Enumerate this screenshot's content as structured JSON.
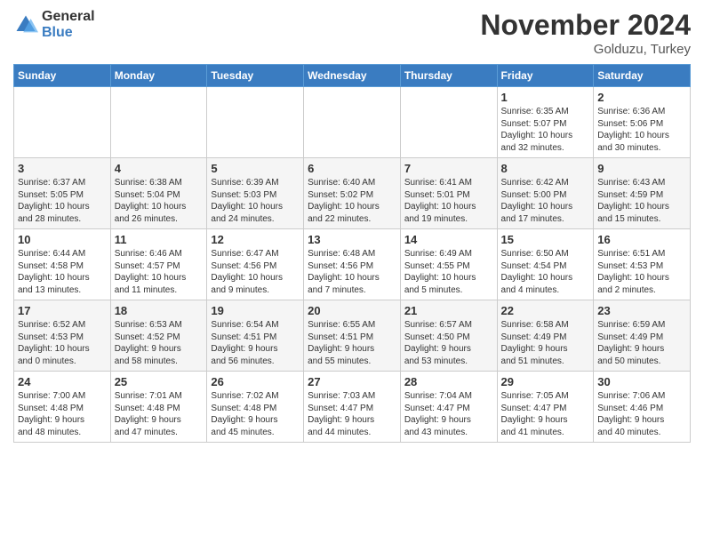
{
  "logo": {
    "general": "General",
    "blue": "Blue"
  },
  "title": "November 2024",
  "location": "Golduzu, Turkey",
  "days_of_week": [
    "Sunday",
    "Monday",
    "Tuesday",
    "Wednesday",
    "Thursday",
    "Friday",
    "Saturday"
  ],
  "weeks": [
    [
      {
        "day": "",
        "info": ""
      },
      {
        "day": "",
        "info": ""
      },
      {
        "day": "",
        "info": ""
      },
      {
        "day": "",
        "info": ""
      },
      {
        "day": "",
        "info": ""
      },
      {
        "day": "1",
        "info": "Sunrise: 6:35 AM\nSunset: 5:07 PM\nDaylight: 10 hours\nand 32 minutes."
      },
      {
        "day": "2",
        "info": "Sunrise: 6:36 AM\nSunset: 5:06 PM\nDaylight: 10 hours\nand 30 minutes."
      }
    ],
    [
      {
        "day": "3",
        "info": "Sunrise: 6:37 AM\nSunset: 5:05 PM\nDaylight: 10 hours\nand 28 minutes."
      },
      {
        "day": "4",
        "info": "Sunrise: 6:38 AM\nSunset: 5:04 PM\nDaylight: 10 hours\nand 26 minutes."
      },
      {
        "day": "5",
        "info": "Sunrise: 6:39 AM\nSunset: 5:03 PM\nDaylight: 10 hours\nand 24 minutes."
      },
      {
        "day": "6",
        "info": "Sunrise: 6:40 AM\nSunset: 5:02 PM\nDaylight: 10 hours\nand 22 minutes."
      },
      {
        "day": "7",
        "info": "Sunrise: 6:41 AM\nSunset: 5:01 PM\nDaylight: 10 hours\nand 19 minutes."
      },
      {
        "day": "8",
        "info": "Sunrise: 6:42 AM\nSunset: 5:00 PM\nDaylight: 10 hours\nand 17 minutes."
      },
      {
        "day": "9",
        "info": "Sunrise: 6:43 AM\nSunset: 4:59 PM\nDaylight: 10 hours\nand 15 minutes."
      }
    ],
    [
      {
        "day": "10",
        "info": "Sunrise: 6:44 AM\nSunset: 4:58 PM\nDaylight: 10 hours\nand 13 minutes."
      },
      {
        "day": "11",
        "info": "Sunrise: 6:46 AM\nSunset: 4:57 PM\nDaylight: 10 hours\nand 11 minutes."
      },
      {
        "day": "12",
        "info": "Sunrise: 6:47 AM\nSunset: 4:56 PM\nDaylight: 10 hours\nand 9 minutes."
      },
      {
        "day": "13",
        "info": "Sunrise: 6:48 AM\nSunset: 4:56 PM\nDaylight: 10 hours\nand 7 minutes."
      },
      {
        "day": "14",
        "info": "Sunrise: 6:49 AM\nSunset: 4:55 PM\nDaylight: 10 hours\nand 5 minutes."
      },
      {
        "day": "15",
        "info": "Sunrise: 6:50 AM\nSunset: 4:54 PM\nDaylight: 10 hours\nand 4 minutes."
      },
      {
        "day": "16",
        "info": "Sunrise: 6:51 AM\nSunset: 4:53 PM\nDaylight: 10 hours\nand 2 minutes."
      }
    ],
    [
      {
        "day": "17",
        "info": "Sunrise: 6:52 AM\nSunset: 4:53 PM\nDaylight: 10 hours\nand 0 minutes."
      },
      {
        "day": "18",
        "info": "Sunrise: 6:53 AM\nSunset: 4:52 PM\nDaylight: 9 hours\nand 58 minutes."
      },
      {
        "day": "19",
        "info": "Sunrise: 6:54 AM\nSunset: 4:51 PM\nDaylight: 9 hours\nand 56 minutes."
      },
      {
        "day": "20",
        "info": "Sunrise: 6:55 AM\nSunset: 4:51 PM\nDaylight: 9 hours\nand 55 minutes."
      },
      {
        "day": "21",
        "info": "Sunrise: 6:57 AM\nSunset: 4:50 PM\nDaylight: 9 hours\nand 53 minutes."
      },
      {
        "day": "22",
        "info": "Sunrise: 6:58 AM\nSunset: 4:49 PM\nDaylight: 9 hours\nand 51 minutes."
      },
      {
        "day": "23",
        "info": "Sunrise: 6:59 AM\nSunset: 4:49 PM\nDaylight: 9 hours\nand 50 minutes."
      }
    ],
    [
      {
        "day": "24",
        "info": "Sunrise: 7:00 AM\nSunset: 4:48 PM\nDaylight: 9 hours\nand 48 minutes."
      },
      {
        "day": "25",
        "info": "Sunrise: 7:01 AM\nSunset: 4:48 PM\nDaylight: 9 hours\nand 47 minutes."
      },
      {
        "day": "26",
        "info": "Sunrise: 7:02 AM\nSunset: 4:48 PM\nDaylight: 9 hours\nand 45 minutes."
      },
      {
        "day": "27",
        "info": "Sunrise: 7:03 AM\nSunset: 4:47 PM\nDaylight: 9 hours\nand 44 minutes."
      },
      {
        "day": "28",
        "info": "Sunrise: 7:04 AM\nSunset: 4:47 PM\nDaylight: 9 hours\nand 43 minutes."
      },
      {
        "day": "29",
        "info": "Sunrise: 7:05 AM\nSunset: 4:47 PM\nDaylight: 9 hours\nand 41 minutes."
      },
      {
        "day": "30",
        "info": "Sunrise: 7:06 AM\nSunset: 4:46 PM\nDaylight: 9 hours\nand 40 minutes."
      }
    ]
  ]
}
